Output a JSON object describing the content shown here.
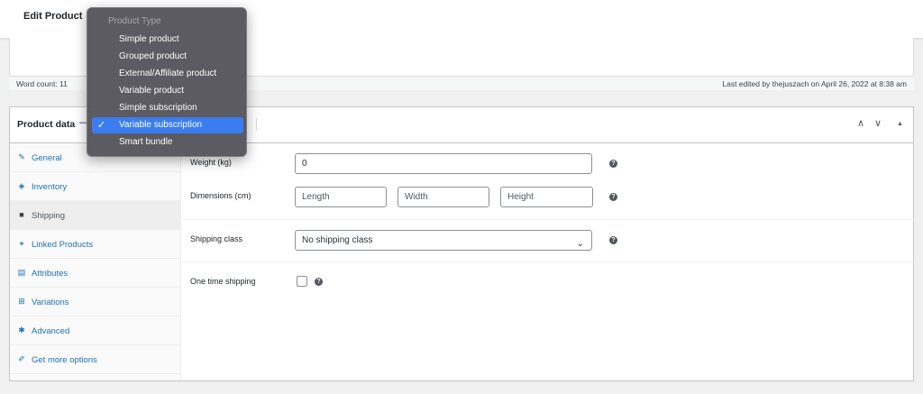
{
  "header": {
    "title": "Edit Product"
  },
  "editor": {
    "word_count": "Word count: 11",
    "last_edited": "Last edited by thejuszach on April 26, 2022 at 8:38 am"
  },
  "product_data": {
    "label": "Product data",
    "dash": "—",
    "controls": {
      "up": "∧",
      "down": "∨",
      "toggle": "▲"
    }
  },
  "dropdown": {
    "header": "Product Type",
    "options": [
      "Simple product",
      "Grouped product",
      "External/Affiliate product",
      "Variable product",
      "Simple subscription",
      "Variable subscription",
      "Smart bundle"
    ],
    "selected": "Variable subscription",
    "checkmark": "✓"
  },
  "tabs": [
    {
      "label": "General",
      "icon": "wrench-icon",
      "glyph": "✎"
    },
    {
      "label": "Inventory",
      "icon": "tag-icon",
      "glyph": "◈"
    },
    {
      "label": "Shipping",
      "icon": "truck-icon",
      "glyph": "■"
    },
    {
      "label": "Linked Products",
      "icon": "link-icon",
      "glyph": "⚭"
    },
    {
      "label": "Attributes",
      "icon": "list-icon",
      "glyph": "▤"
    },
    {
      "label": "Variations",
      "icon": "grid-icon",
      "glyph": "⊞"
    },
    {
      "label": "Advanced",
      "icon": "gear-icon",
      "glyph": "✱"
    },
    {
      "label": "Get more options",
      "icon": "plugin-icon",
      "glyph": "✐"
    }
  ],
  "active_tab": "Shipping",
  "shipping": {
    "weight_label": "Weight (kg)",
    "weight_value": "0",
    "dimensions_label": "Dimensions (cm)",
    "length_placeholder": "Length",
    "width_placeholder": "Width",
    "height_placeholder": "Height",
    "class_label": "Shipping class",
    "class_value": "No shipping class",
    "one_time_label": "One time shipping",
    "help_glyph": "?"
  },
  "colors": {
    "link": "#2271b1",
    "menu_selected": "#3b7df0",
    "menu_bg": "#56565c"
  }
}
